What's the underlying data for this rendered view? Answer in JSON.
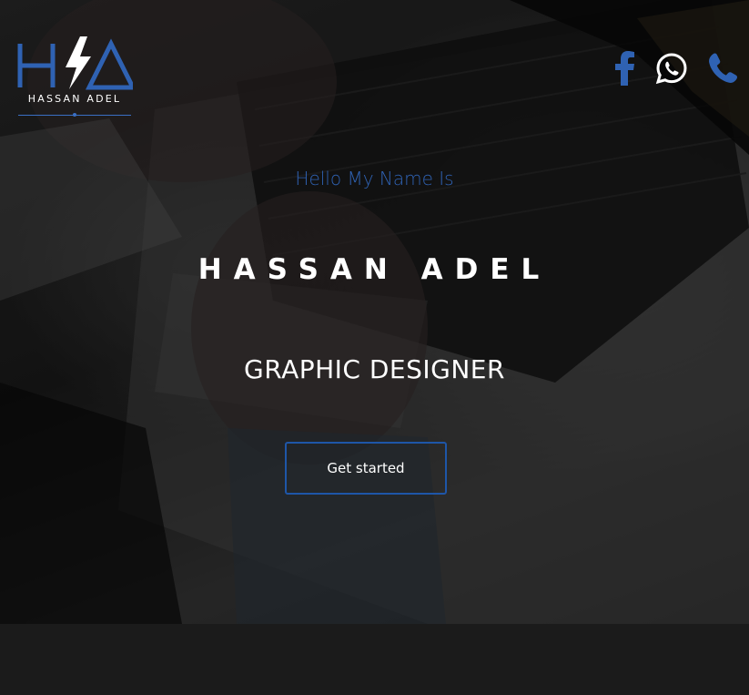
{
  "logo": {
    "initials_icon": "ha-lightning-logo",
    "name": "HASSAN ADEL"
  },
  "social": {
    "facebook_icon": "facebook-icon",
    "whatsapp_icon": "whatsapp-icon",
    "phone_icon": "phone-icon"
  },
  "hero": {
    "greeting": "Hello My Name Is",
    "name": "HASSAN ADEL",
    "role": "GRAPHIC DESIGNER",
    "cta_label": "Get started"
  },
  "colors": {
    "accent": "#2f62b3",
    "button_border": "#1e56a8",
    "text": "#ffffff",
    "background": "#1a1a1a"
  }
}
